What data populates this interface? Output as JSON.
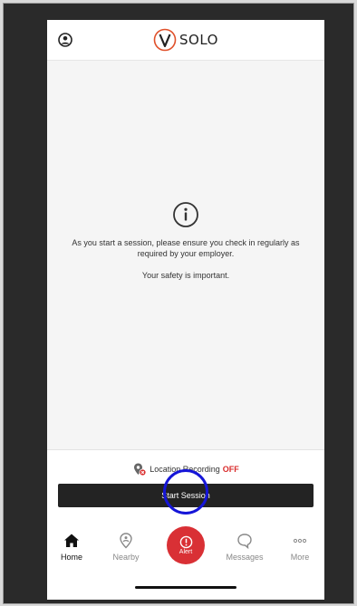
{
  "header": {
    "app_name": "SOLO",
    "brand_color": "#e0502a",
    "profile_icon": "person-circle-icon"
  },
  "main": {
    "info_icon": "info-circle-icon",
    "message": "As you start a session, please ensure you check in regularly as required by your employer.",
    "safety_text": "Your safety is important."
  },
  "location": {
    "label": "Location Recording",
    "status": "OFF",
    "status_color": "#d92b2b",
    "icon": "location-pin-off-icon"
  },
  "session": {
    "start_label": "Start Session"
  },
  "tabbar": {
    "items": [
      {
        "label": "Home",
        "icon": "home-icon",
        "active": true
      },
      {
        "label": "Nearby",
        "icon": "nearby-pin-icon",
        "active": false
      },
      {
        "label": "Alert",
        "icon": "alert-exclamation-icon",
        "active": false,
        "color": "#d93035"
      },
      {
        "label": "Messages",
        "icon": "chat-bubble-icon",
        "active": false
      },
      {
        "label": "More",
        "icon": "more-dots-icon",
        "active": false
      }
    ]
  }
}
